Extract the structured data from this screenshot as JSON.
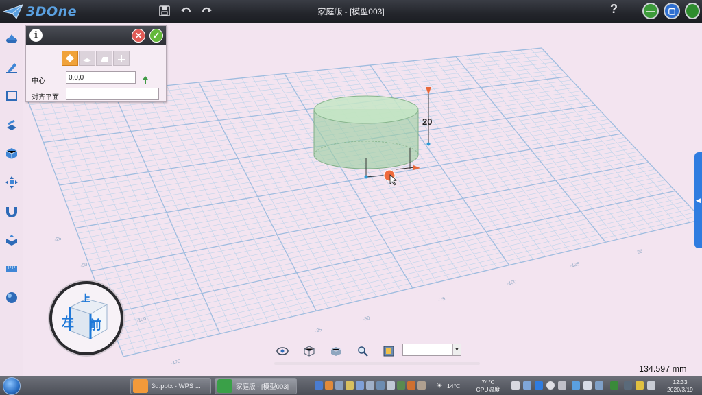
{
  "app": {
    "logo_text": "3DOne",
    "title": "家庭版 - [模型003]",
    "help_label": "?"
  },
  "toolbar_icons": [
    "save-icon",
    "undo-icon",
    "redo-icon"
  ],
  "left_tools": [
    "basic-shape-icon",
    "sketch-icon",
    "sketch-edit-icon",
    "feature-modeling-icon",
    "special-function-icon",
    "basic-edit-icon",
    "magnet-icon",
    "combination-icon",
    "distance-measure-icon",
    "render-material-icon"
  ],
  "panel": {
    "info_label": "i",
    "center_label": "中心",
    "center_value": "0,0,0",
    "align_plane_label": "对齐平面",
    "align_plane_value": ""
  },
  "viewport": {
    "dimension_value": "20",
    "axis_ticks": [
      "-25",
      "-50",
      "-75",
      "-100",
      "-125",
      "-25",
      "-50",
      "-75",
      "-100",
      "-125",
      "25"
    ]
  },
  "view_cube": {
    "top": "上",
    "left": "左",
    "front": "前"
  },
  "view_tools": [
    "view-eye-icon",
    "view-cube-icon",
    "view-render-icon",
    "zoom-icon",
    "view-fit-icon"
  ],
  "view_select_value": "",
  "scale_readout": "134.597 mm",
  "taskbar": {
    "tasks": [
      {
        "label": "3d.pptx - WPS ...",
        "icon_color": "#f39a3a"
      },
      {
        "label": "家庭版 - [模型003]",
        "icon_color": "#3aa048"
      }
    ],
    "weather": "14℃",
    "cpu_temp": "74℃",
    "cpu_label": "CPU温度",
    "time": "12:33",
    "date": "2020/3/19"
  },
  "colors": {
    "background": "#f3e4f0",
    "grid_line": "#bcd3ea",
    "grid_major": "#9ebcdf",
    "cylinder": "#9fd0a4",
    "accent": "#f0a23a"
  }
}
